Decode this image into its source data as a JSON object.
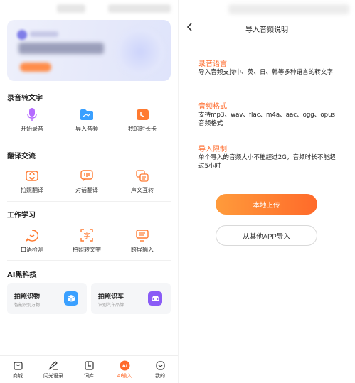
{
  "left": {
    "sections": [
      {
        "title": "录音转文字",
        "items": [
          {
            "label": "开始录音",
            "icon": "microphone-icon",
            "color": "#b56bff"
          },
          {
            "label": "导入音频",
            "icon": "folder-icon",
            "color": "#3aa0ff"
          },
          {
            "label": "我的时长卡",
            "icon": "clock-card-icon",
            "color": "#ff7a30"
          }
        ]
      },
      {
        "title": "翻译交流",
        "items": [
          {
            "label": "拍照翻译",
            "icon": "photo-translate-icon",
            "color": "#ff7a30"
          },
          {
            "label": "对话翻译",
            "icon": "dialog-translate-icon",
            "color": "#ff7a30"
          },
          {
            "label": "声文互转",
            "icon": "voice-text-icon",
            "color": "#ff7a30"
          }
        ]
      },
      {
        "title": "工作学习",
        "items": [
          {
            "label": "口语检测",
            "icon": "speech-check-icon",
            "color": "#ff7a30"
          },
          {
            "label": "拍照转文字",
            "icon": "scan-text-icon",
            "color": "#ff7a30"
          },
          {
            "label": "跨屏输入",
            "icon": "cross-screen-icon",
            "color": "#ff7a30"
          }
        ]
      }
    ],
    "ai_section": {
      "title": "AI黑科技",
      "cards": [
        {
          "title": "拍照识物",
          "subtitle": "智能识别万物",
          "icon": "cube-icon",
          "color": "#3aa0ff"
        },
        {
          "title": "拍照识车",
          "subtitle": "识别汽车品牌",
          "icon": "car-icon",
          "color": "#8a5cf6"
        }
      ]
    },
    "tabbar": [
      {
        "label": "商城",
        "icon": "shop-icon",
        "active": false
      },
      {
        "label": "闪光语录",
        "icon": "quote-pen-icon",
        "active": false
      },
      {
        "label": "词库",
        "icon": "dictionary-icon",
        "active": false
      },
      {
        "label": "AI输入",
        "icon": "ai-badge-icon",
        "active": true,
        "badge": "AI"
      },
      {
        "label": "我的",
        "icon": "profile-icon",
        "active": false
      }
    ],
    "accent": "#ff6a2a"
  },
  "right": {
    "title": "导入音频说明",
    "blocks": [
      {
        "heading": "录音语言",
        "body": "导入音频支持中、英、日、韩等多种语言的转文字"
      },
      {
        "heading": "音频格式",
        "body": "支持mp3、wav、flac、m4a、aac、ogg、opus音频格式"
      },
      {
        "heading": "导入限制",
        "body": "单个导入的音频大小不能超过2G，音频时长不能超过5小时"
      }
    ],
    "primary_button": "本地上传",
    "secondary_button": "从其他APP导入",
    "accent": "#ff6a2a"
  }
}
